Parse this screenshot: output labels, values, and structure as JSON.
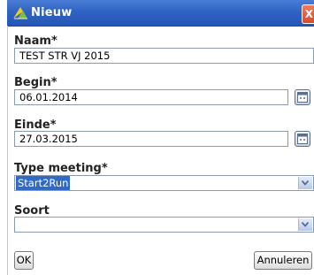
{
  "dialog": {
    "title": "Nieuw",
    "close_glyph": "X",
    "app_icon": "app-logo-icon"
  },
  "fields": {
    "naam": {
      "label": "Naam*",
      "value": "TEST STR VJ 2015"
    },
    "begin": {
      "label": "Begin*",
      "value": "06.01.2014",
      "picker_icon": "calendar-icon"
    },
    "einde": {
      "label": "Einde*",
      "value": "27.03.2015",
      "picker_icon": "calendar-icon"
    },
    "type_meeting": {
      "label": "Type meeting*",
      "value": "Start2Run"
    },
    "soort": {
      "label": "Soort",
      "value": ""
    }
  },
  "buttons": {
    "ok": "OK",
    "cancel": "Annuleren"
  },
  "colors": {
    "titlebar": "#2f62c2",
    "selection": "#316ac5",
    "close": "#d64a2c"
  }
}
